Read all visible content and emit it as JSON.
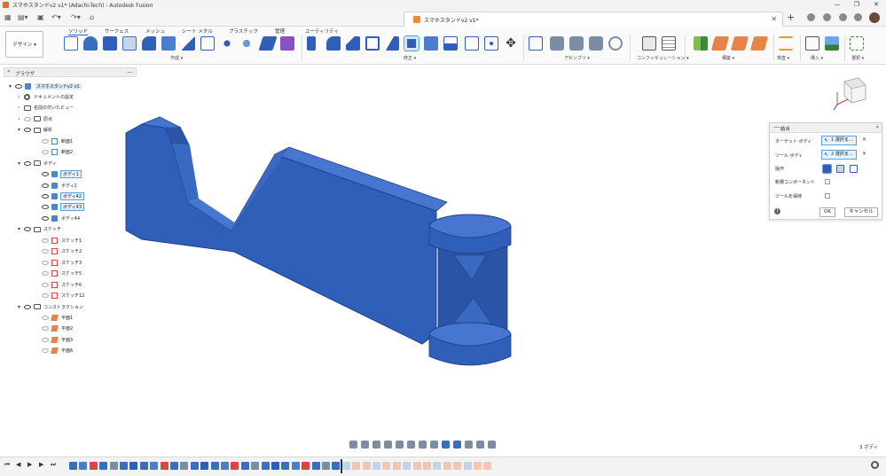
{
  "window": {
    "title": "スマホスタンドv2 v1* (Adachi-Tech) - Autodesk Fusion",
    "controls": [
      "—",
      "❐",
      "✕"
    ]
  },
  "doc_tab": {
    "label": "スマホスタンドv2 v1*",
    "close": "✕"
  },
  "ribbon": {
    "workspace": "デザイン ▾",
    "tabs": [
      "ソリッド",
      "サーフェス",
      "メッシュ",
      "シート メタル",
      "プラスチック",
      "管理",
      "ユーティリティ"
    ],
    "active_tab": "ソリッド",
    "groups": [
      "作成 ▾",
      "修正 ▾",
      "アセンブリ ▾",
      "コンフィギュレーション ▾",
      "構築 ▾",
      "検査 ▾",
      "挿入 ▾",
      "選択 ▾"
    ]
  },
  "browser": {
    "title": "ブラウザ",
    "collapse": "—",
    "items": [
      {
        "label": "スマホスタンドv2 v1",
        "level": 0,
        "type": "root",
        "arrow": "▾",
        "highlight": false
      },
      {
        "label": "ドキュメントの設定",
        "level": 1,
        "type": "settings",
        "arrow": "›",
        "highlight": false
      },
      {
        "label": "名前の付いたビュー",
        "level": 1,
        "type": "folder",
        "arrow": "›",
        "highlight": false
      },
      {
        "label": "原点",
        "level": 1,
        "type": "folder",
        "arrow": "›",
        "highlight": false
      },
      {
        "label": "解析",
        "level": 1,
        "type": "folder",
        "arrow": "▾",
        "highlight": false
      },
      {
        "label": "断面1",
        "level": 2,
        "type": "section",
        "arrow": "",
        "highlight": false
      },
      {
        "label": "断面2",
        "level": 2,
        "type": "section",
        "arrow": "",
        "highlight": false
      },
      {
        "label": "ボディ",
        "level": 1,
        "type": "folder",
        "arrow": "▾",
        "highlight": false
      },
      {
        "label": "ボディ1",
        "level": 2,
        "type": "body",
        "arrow": "",
        "highlight": true
      },
      {
        "label": "ボディ2",
        "level": 2,
        "type": "body",
        "arrow": "",
        "highlight": false
      },
      {
        "label": "ボディ42",
        "level": 2,
        "type": "body",
        "arrow": "",
        "highlight": true
      },
      {
        "label": "ボディ43",
        "level": 2,
        "type": "body",
        "arrow": "",
        "highlight": true
      },
      {
        "label": "ボディ44",
        "level": 2,
        "type": "body",
        "arrow": "",
        "highlight": false
      },
      {
        "label": "スケッチ",
        "level": 1,
        "type": "folder",
        "arrow": "▾",
        "highlight": false
      },
      {
        "label": "スケッチ1",
        "level": 2,
        "type": "sketch",
        "arrow": "",
        "highlight": false
      },
      {
        "label": "スケッチ2",
        "level": 2,
        "type": "sketch",
        "arrow": "",
        "highlight": false
      },
      {
        "label": "スケッチ3",
        "level": 2,
        "type": "sketch",
        "arrow": "",
        "highlight": false
      },
      {
        "label": "スケッチ5",
        "level": 2,
        "type": "sketch",
        "arrow": "",
        "highlight": false
      },
      {
        "label": "スケッチ6",
        "level": 2,
        "type": "sketch",
        "arrow": "",
        "highlight": false
      },
      {
        "label": "スケッチ12",
        "level": 2,
        "type": "sketch",
        "arrow": "",
        "highlight": false
      },
      {
        "label": "コンストラクション",
        "level": 1,
        "type": "folder",
        "arrow": "▾",
        "highlight": false
      },
      {
        "label": "平面1",
        "level": 2,
        "type": "plane",
        "arrow": "",
        "highlight": false
      },
      {
        "label": "平面2",
        "level": 2,
        "type": "plane",
        "arrow": "",
        "highlight": false
      },
      {
        "label": "平面3",
        "level": 2,
        "type": "plane",
        "arrow": "",
        "highlight": false
      },
      {
        "label": "平面6",
        "level": 2,
        "type": "plane",
        "arrow": "",
        "highlight": false
      }
    ]
  },
  "dialog": {
    "title": "結合",
    "collapse": "—",
    "expand": "»",
    "target_label": "ターゲット ボディ",
    "target_value": "1 選択ま...",
    "tool_label": "ツール ボディ",
    "tool_value": "2 選択ま...",
    "clear": "✕",
    "operation_label": "操作",
    "new_component_label": "新規コンポーネント",
    "keep_tools_label": "ツールを保持",
    "ok": "OK",
    "cancel": "キャンセル",
    "info": "i"
  },
  "status": {
    "body_count": "3 ボディ"
  },
  "timeline": {
    "controls": [
      "⏮",
      "◀",
      "▶",
      "▶",
      "⏭"
    ]
  },
  "colors": {
    "body_blue": "#2f5fb8",
    "body_dark": "#1f3f86",
    "body_top": "#4676d0",
    "accent": "#0b74d5"
  }
}
